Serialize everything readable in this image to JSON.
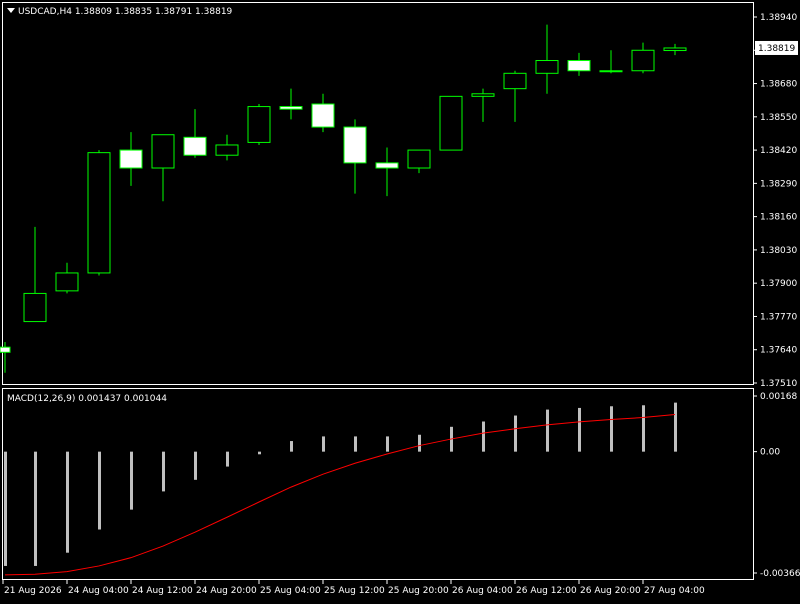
{
  "window": {
    "title": "USDCAD,H4  1.38809 1.38835 1.38791 1.38819",
    "menu_icon": "triangle-down-icon"
  },
  "colors": {
    "background": "#000000",
    "bull_candle_border": "#00ff00",
    "bear_candle_border": "#00ff00",
    "bull_candle_fill": "#000000",
    "bear_candle_fill": "#ffffff",
    "axis": "#ffffff",
    "macd_hist": "#c0c0c0",
    "signal_line": "#ff0000",
    "price_label_bg": "#ffffff",
    "price_label_text": "#000000"
  },
  "chart_data": [
    {
      "type": "candlestick",
      "title": "USDCAD,H4  1.38809 1.38835 1.38791 1.38819",
      "symbol": "USDCAD",
      "timeframe": "H4",
      "ylim": [
        1.3751,
        1.3894
      ],
      "y_ticks": [
        "1.38940",
        "1.38810",
        "1.38680",
        "1.38550",
        "1.38420",
        "1.38290",
        "1.38160",
        "1.38030",
        "1.37900",
        "1.37770",
        "1.37640",
        "1.37510"
      ],
      "current_price": "1.38819",
      "x_tick_labels": [
        "21 Aug 2026",
        "24 Aug 04:00",
        "24 Aug 12:00",
        "24 Aug 20:00",
        "25 Aug 04:00",
        "25 Aug 12:00",
        "25 Aug 20:00",
        "26 Aug 04:00",
        "26 Aug 12:00",
        "26 Aug 20:00",
        "27 Aug 04:00"
      ],
      "candles": [
        {
          "o": 1.3765,
          "h": 1.3767,
          "l": 1.3755,
          "c": 1.3763
        },
        {
          "o": 1.3775,
          "h": 1.3812,
          "l": 1.3775,
          "c": 1.3786
        },
        {
          "o": 1.3787,
          "h": 1.3798,
          "l": 1.3786,
          "c": 1.3794
        },
        {
          "o": 1.3794,
          "h": 1.3842,
          "l": 1.3793,
          "c": 1.3841
        },
        {
          "o": 1.3842,
          "h": 1.3849,
          "l": 1.3828,
          "c": 1.3835
        },
        {
          "o": 1.3835,
          "h": 1.3848,
          "l": 1.3822,
          "c": 1.3848
        },
        {
          "o": 1.3847,
          "h": 1.3858,
          "l": 1.3839,
          "c": 1.384
        },
        {
          "o": 1.384,
          "h": 1.3848,
          "l": 1.3838,
          "c": 1.3844
        },
        {
          "o": 1.3845,
          "h": 1.386,
          "l": 1.3844,
          "c": 1.3859
        },
        {
          "o": 1.3859,
          "h": 1.3866,
          "l": 1.3854,
          "c": 1.3858
        },
        {
          "o": 1.386,
          "h": 1.3864,
          "l": 1.3849,
          "c": 1.3851
        },
        {
          "o": 1.3851,
          "h": 1.3854,
          "l": 1.3825,
          "c": 1.3837
        },
        {
          "o": 1.3837,
          "h": 1.3843,
          "l": 1.3824,
          "c": 1.3835
        },
        {
          "o": 1.3835,
          "h": 1.3842,
          "l": 1.3833,
          "c": 1.3842
        },
        {
          "o": 1.3842,
          "h": 1.3863,
          "l": 1.3842,
          "c": 1.3863
        },
        {
          "o": 1.3863,
          "h": 1.3866,
          "l": 1.3853,
          "c": 1.3864
        },
        {
          "o": 1.3866,
          "h": 1.3873,
          "l": 1.3853,
          "c": 1.3872
        },
        {
          "o": 1.3872,
          "h": 1.3891,
          "l": 1.3864,
          "c": 1.3877
        },
        {
          "o": 1.3877,
          "h": 1.388,
          "l": 1.3871,
          "c": 1.3873
        },
        {
          "o": 1.3873,
          "h": 1.3881,
          "l": 1.3872,
          "c": 1.3873
        },
        {
          "o": 1.3873,
          "h": 1.3884,
          "l": 1.3872,
          "c": 1.3881
        },
        {
          "o": 1.38809,
          "h": 1.38835,
          "l": 1.38791,
          "c": 1.38819
        }
      ]
    },
    {
      "type": "bar+line",
      "title": "MACD(12,26,9) 0.001437 0.001044",
      "ylim": [
        -0.003663,
        0.00168
      ],
      "y_ticks": [
        "0.00168",
        "0.00",
        "-0.003663"
      ],
      "histogram": [
        -0.00345,
        -0.00345,
        -0.00305,
        -0.00235,
        -0.00175,
        -0.0012,
        -0.00085,
        -0.00045,
        -8e-05,
        0.00032,
        0.00046,
        0.00046,
        0.00046,
        0.00051,
        0.00075,
        0.00091,
        0.00109,
        0.00127,
        0.00132,
        0.00137,
        0.0014,
        0.00148
      ],
      "signal": [
        -0.00372,
        -0.0037,
        -0.00362,
        -0.00345,
        -0.0032,
        -0.00285,
        -0.00243,
        -0.00198,
        -0.00152,
        -0.00107,
        -0.00068,
        -0.00035,
        -7e-05,
        0.00018,
        0.00038,
        0.00056,
        0.00069,
        0.00081,
        0.0009,
        0.00097,
        0.00103,
        0.00112
      ]
    }
  ]
}
